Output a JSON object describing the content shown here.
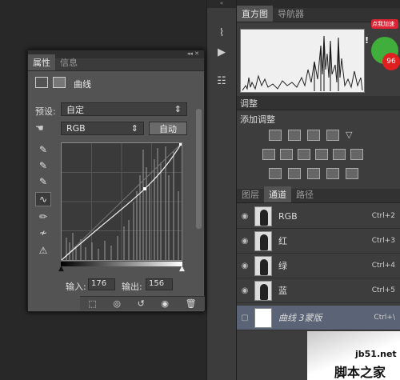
{
  "toolstrip": {
    "icons": [
      "curve-tool-icon",
      "play-icon",
      "layers-tool-icon"
    ]
  },
  "histogram_panel": {
    "tabs": [
      "直方图",
      "导航器"
    ],
    "warning": "!"
  },
  "ad_badge": {
    "text": "点我加速",
    "percent": "96"
  },
  "adjustments": {
    "tab": "调整",
    "title": "添加调整"
  },
  "layers_panel": {
    "tabs": [
      "图层",
      "通道",
      "路径"
    ],
    "channels": [
      {
        "name": "RGB",
        "shortcut": "Ctrl+2"
      },
      {
        "name": "红",
        "shortcut": "Ctrl+3"
      },
      {
        "name": "绿",
        "shortcut": "Ctrl+4"
      },
      {
        "name": "蓝",
        "shortcut": "Ctrl+5"
      },
      {
        "name": "曲线 3蒙版",
        "shortcut": "Ctrl+\\"
      }
    ]
  },
  "properties": {
    "tabs": [
      "属性",
      "信息"
    ],
    "title": "曲线",
    "preset_label": "预设:",
    "preset_value": "自定",
    "channel_value": "RGB",
    "auto_label": "自动",
    "input_label": "输入:",
    "input_value": "176",
    "output_label": "输出:",
    "output_value": "156"
  },
  "watermark": {
    "site": "jb51.net",
    "brand": "脚本之家"
  }
}
